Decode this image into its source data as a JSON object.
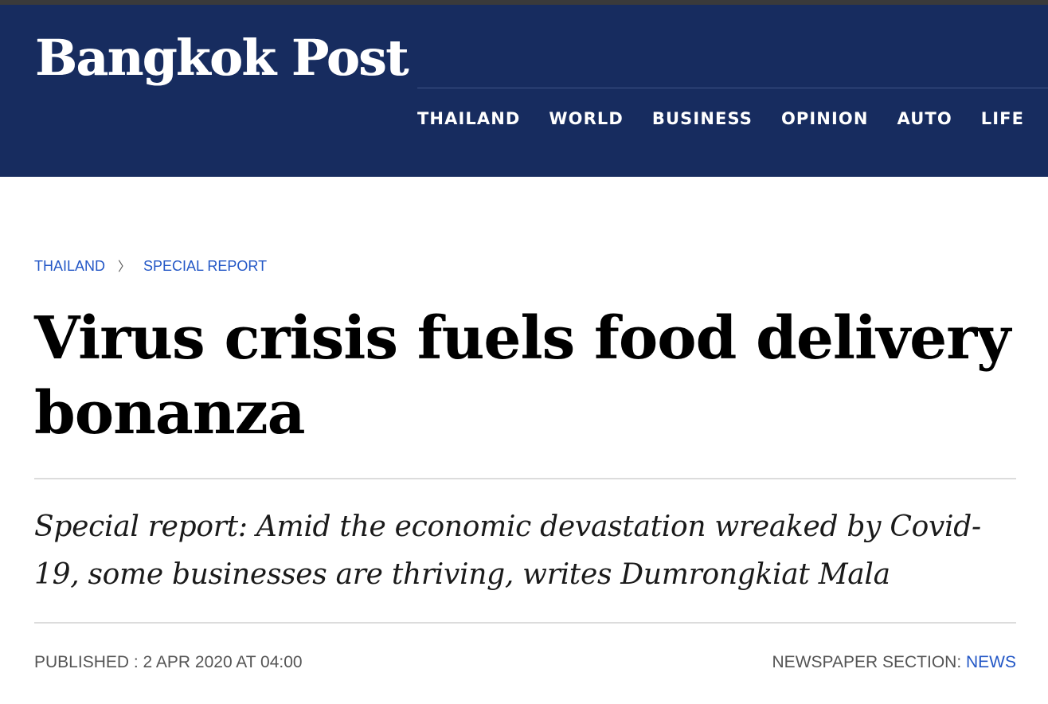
{
  "masthead": {
    "logo_text": "Bangkok Post",
    "background": "#172c5f",
    "nav": [
      "THAILAND",
      "WORLD",
      "BUSINESS",
      "OPINION",
      "AUTO",
      "LIFE"
    ]
  },
  "breadcrumb": {
    "items": [
      "THAILAND",
      "SPECIAL REPORT"
    ],
    "separator": "〉",
    "link_color": "#2357c6"
  },
  "article": {
    "headline": "Virus crisis fuels food delivery bonanza",
    "standfirst": "Special report: Amid the economic devastation wreaked by Covid-19, some businesses are thriving, writes Dumrongkiat Mala",
    "published": "PUBLISHED : 2 APR 2020 AT 04:00",
    "section_label": "NEWSPAPER SECTION: ",
    "section_value": "NEWS"
  }
}
